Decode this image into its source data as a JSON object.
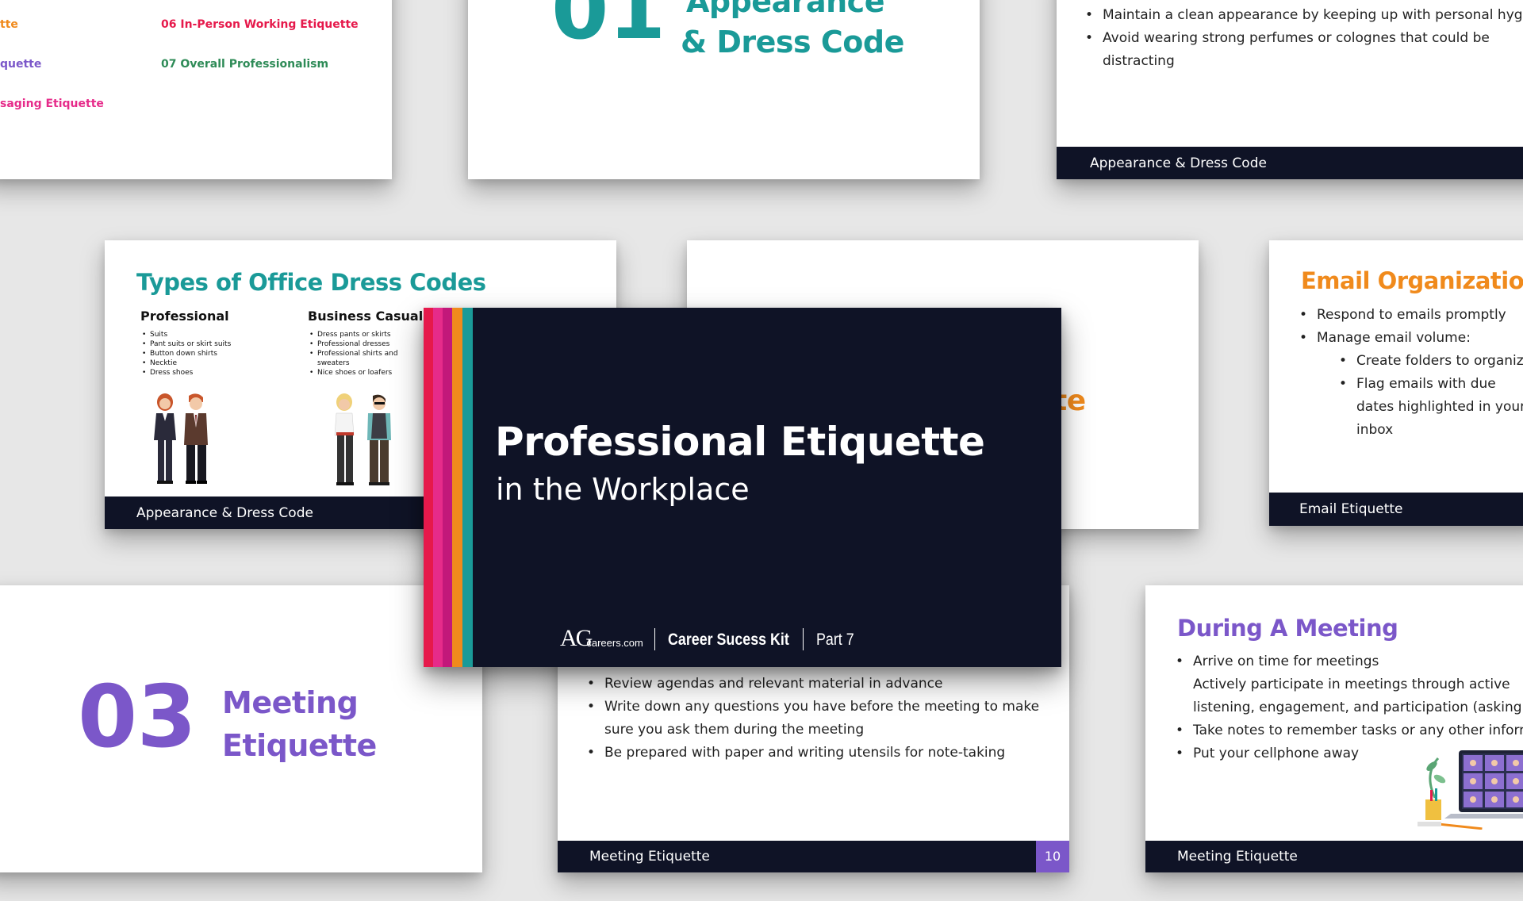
{
  "toc": {
    "items": [
      {
        "text": "tte",
        "color": "#f08a1c"
      },
      {
        "text": "06  In-Person Working Etiquette",
        "color": "#e6194b"
      },
      {
        "text": "quette",
        "color": "#7b57c9"
      },
      {
        "text": "07  Overall Professionalism",
        "color": "#2e8b57"
      },
      {
        "text": "saging Etiquette",
        "color": "#e62b8a"
      }
    ]
  },
  "section01": {
    "number": "01",
    "title_line1": "Appearance",
    "title_line2": "& Dress Code"
  },
  "hygiene": {
    "bullets": [
      "Maintain a clean appearance by keeping up with personal hygiene",
      "Avoid wearing strong perfumes or colognes that could be distracting"
    ],
    "footer": "Appearance & Dress Code"
  },
  "dress_codes": {
    "title": "Types of Office Dress Codes",
    "col1": {
      "heading": "Professional",
      "items": [
        "Suits",
        "Pant suits or skirt suits",
        "Button down shirts",
        "Necktie",
        "Dress shoes"
      ]
    },
    "col2": {
      "heading": "Business Casual",
      "items": [
        "Dress pants or skirts",
        "Professional dresses",
        "Professional shirts and sweaters",
        "Nice shoes or loafers"
      ]
    },
    "footer": "Appearance & Dress Code"
  },
  "hidden_slide": {
    "partial_title": "te"
  },
  "email_org": {
    "title": "Email Organization",
    "bullets": [
      "Respond to emails promptly",
      "Manage email volume:"
    ],
    "sub_bullets": [
      "Create folders to organize",
      "Flag emails with due dates highlighted in your inbox"
    ],
    "footer": "Email Etiquette"
  },
  "cover": {
    "title": "Professional Etiquette",
    "subtitle": "in the Workplace",
    "logo_ag": "AG",
    "logo_domain": "careers.com",
    "kit": "Career Sucess Kit",
    "part": "Part 7",
    "stripe_colors": [
      "#e6194b",
      "#e62b8a",
      "#c2187a",
      "#f08a1c",
      "#1a9a98"
    ]
  },
  "section03": {
    "number": "03",
    "title_line1": "Meeting",
    "title_line2": "Etiquette"
  },
  "prep": {
    "bullets": [
      "Review agendas and relevant material in advance",
      "Write down any questions you have before the meeting to make sure you ask them during the meeting",
      "Be prepared with paper and writing utensils for note-taking"
    ],
    "footer": "Meeting Etiquette",
    "page_number": "10"
  },
  "during": {
    "title": "During A Meeting",
    "bullets": [
      "Arrive on time for meetings",
      "Actively participate in meetings through active listening, engagement, and participation (asking questions o",
      "Take notes to remember tasks or any other informa",
      "Put your cellphone away"
    ],
    "footer": "Meeting Etiquette"
  },
  "colors": {
    "navy": "#0f1326",
    "teal": "#1a9a98",
    "orange": "#f08a1c",
    "purple": "#7b57c9",
    "page_num_bg": "#7b57c9"
  }
}
